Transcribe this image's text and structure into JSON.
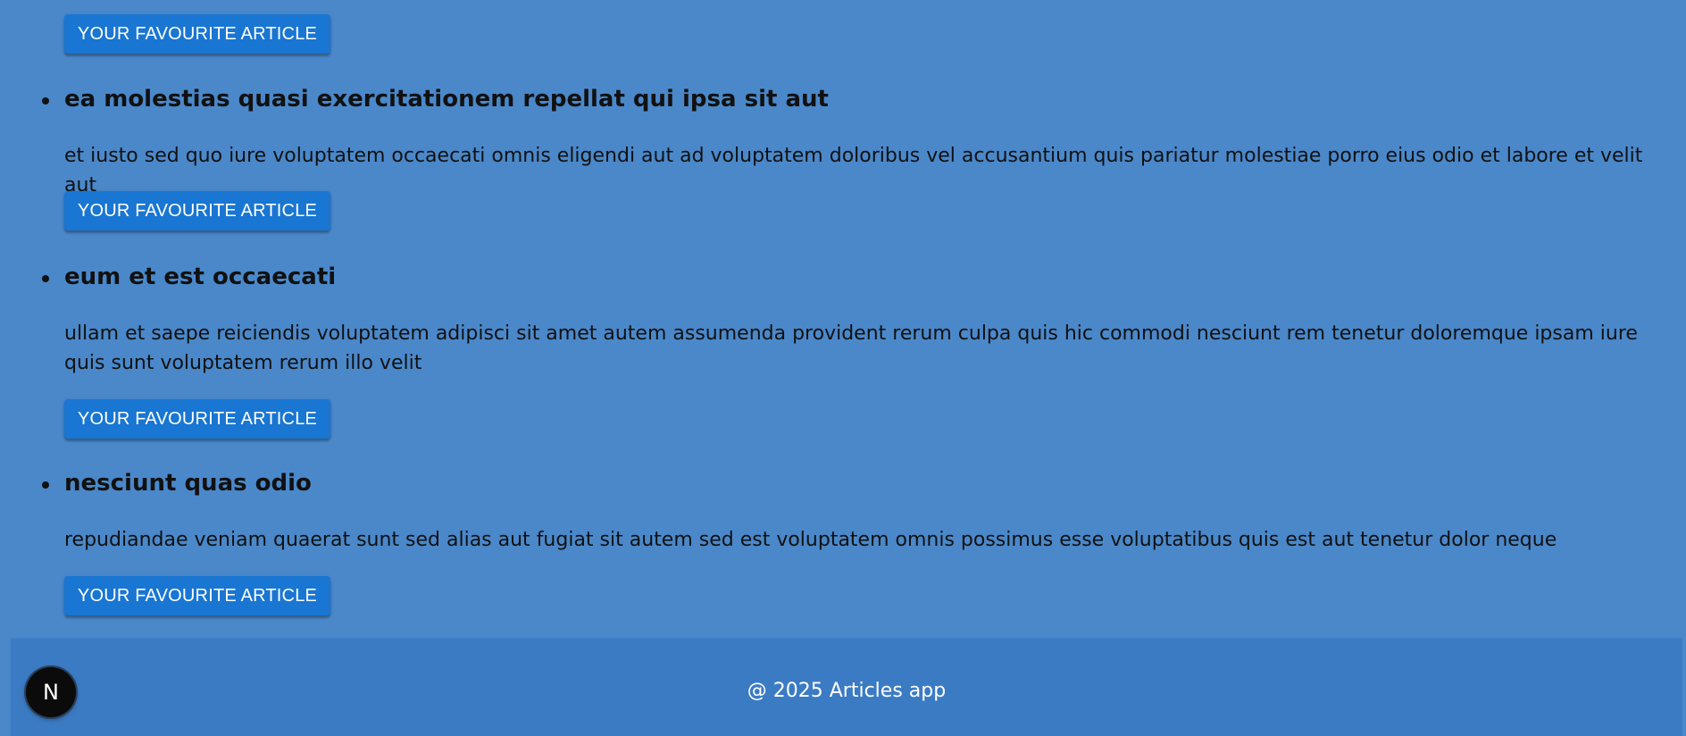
{
  "button_label": "YOUR FAVOURITE ARTICLE",
  "articles": [
    {
      "title": "",
      "body": ""
    },
    {
      "title": "ea molestias quasi exercitationem repellat qui ipsa sit aut",
      "body": "et iusto sed quo iure voluptatem occaecati omnis eligendi aut ad voluptatem doloribus vel accusantium quis pariatur molestiae porro eius odio et labore et velit aut"
    },
    {
      "title": "eum et est occaecati",
      "body": "ullam et saepe reiciendis voluptatem adipisci sit amet autem assumenda provident rerum culpa quis hic commodi nesciunt rem tenetur doloremque ipsam iure quis sunt voluptatem rerum illo velit"
    },
    {
      "title": "nesciunt quas odio",
      "body": "repudiandae veniam quaerat sunt sed alias aut fugiat sit autem sed est voluptatem omnis possimus esse voluptatibus quis est aut tenetur dolor neque"
    }
  ],
  "footer": {
    "text": "@ 2025 Articles app"
  },
  "badge": {
    "label": "N",
    "icon": "nextjs-logo-icon"
  },
  "colors": {
    "background": "#4a88ca",
    "button": "#1976d2",
    "footer": "#3b7bc4"
  }
}
